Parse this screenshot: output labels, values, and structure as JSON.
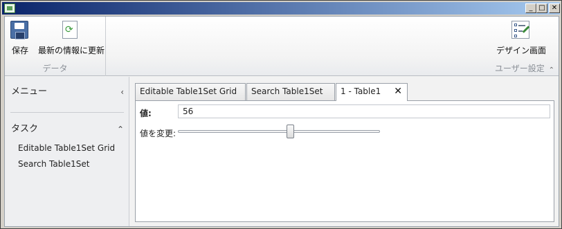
{
  "window": {
    "caption_buttons": [
      "_",
      "□",
      "✕"
    ]
  },
  "ribbon": {
    "groups": [
      {
        "label": "データ",
        "buttons": [
          {
            "label": "保存",
            "icon": "save-icon"
          },
          {
            "label": "最新の情報に更新",
            "icon": "refresh-icon"
          }
        ]
      },
      {
        "label": "ユーザー設定",
        "buttons": [
          {
            "label": "デザイン画面",
            "icon": "design-icon"
          }
        ]
      }
    ],
    "collapse_glyph": "⌃"
  },
  "sidebar": {
    "menu_label": "メニュー",
    "menu_chevron": "‹",
    "task_label": "タスク",
    "task_chevron": "⌃",
    "tasks": [
      "Editable Table1Set Grid",
      "Search Table1Set"
    ]
  },
  "tabs": [
    {
      "label": "Editable Table1Set Grid",
      "active": false
    },
    {
      "label": "Search Table1Set",
      "active": false
    },
    {
      "label": "1 - Table1",
      "active": true,
      "close": "✕"
    }
  ],
  "detail": {
    "value_label": "値:",
    "value": "56",
    "change_label": "値を変更:",
    "slider_value_fraction": 0.56
  }
}
